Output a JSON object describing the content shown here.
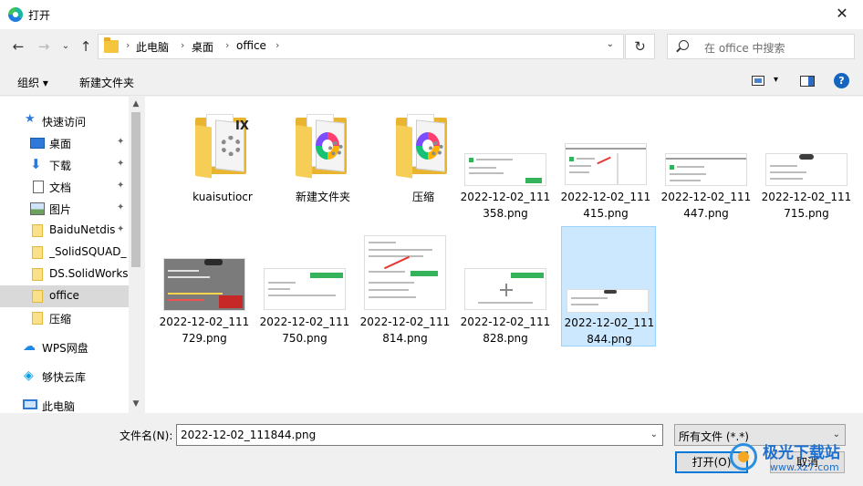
{
  "window": {
    "title": "打开",
    "close_glyph": "✕"
  },
  "address_bar": {
    "crumbs": [
      "此电脑",
      "桌面",
      "office"
    ],
    "separator": "›"
  },
  "search": {
    "placeholder": "在 office 中搜索"
  },
  "toolbar": {
    "organize": "组织 ▾",
    "new_folder": "新建文件夹",
    "help": "?"
  },
  "nav": {
    "items": [
      {
        "label": "快速访问",
        "icon": "star-icon"
      },
      {
        "label": "桌面",
        "icon": "desktop-icon",
        "pinned": true
      },
      {
        "label": "下载",
        "icon": "download-icon",
        "pinned": true
      },
      {
        "label": "文档",
        "icon": "document-icon",
        "pinned": true
      },
      {
        "label": "图片",
        "icon": "picture-icon",
        "pinned": true
      },
      {
        "label": "BaiduNetdis",
        "icon": "folder-icon",
        "pinned": true
      },
      {
        "label": "_SolidSQUAD_",
        "icon": "folder-icon"
      },
      {
        "label": "DS.SolidWorks",
        "icon": "folder-icon"
      },
      {
        "label": "office",
        "icon": "folder-icon",
        "selected": true
      },
      {
        "label": "压缩",
        "icon": "folder-icon"
      },
      {
        "label": "WPS网盘",
        "icon": "cloud-icon"
      },
      {
        "label": "够快云库",
        "icon": "cloud-drive-icon"
      },
      {
        "label": "此电脑",
        "icon": "computer-icon"
      }
    ],
    "pin_glyph": "📌"
  },
  "files": [
    {
      "name": "kuaisutiocr",
      "type": "folder"
    },
    {
      "name": "新建文件夹",
      "type": "folder"
    },
    {
      "name": "压缩",
      "type": "folder"
    },
    {
      "name": "2022-12-02_111358.png",
      "type": "image"
    },
    {
      "name": "2022-12-02_111415.png",
      "type": "image"
    },
    {
      "name": "2022-12-02_111447.png",
      "type": "image"
    },
    {
      "name": "2022-12-02_111715.png",
      "type": "image"
    },
    {
      "name": "2022-12-02_111729.png",
      "type": "image"
    },
    {
      "name": "2022-12-02_111750.png",
      "type": "image"
    },
    {
      "name": "2022-12-02_111814.png",
      "type": "image"
    },
    {
      "name": "2022-12-02_111828.png",
      "type": "image"
    },
    {
      "name": "2022-12-02_111844.png",
      "type": "image",
      "selected": true
    }
  ],
  "footer": {
    "filename_label": "文件名(N):",
    "filename_value": "2022-12-02_111844.png",
    "filetype_value": "所有文件 (*.*)",
    "open_button": "打开(O)",
    "cancel_button": "取消"
  },
  "watermark": {
    "text": "极光下载站",
    "url": "www.xz7.com"
  },
  "colors": {
    "selection": "#cce8ff",
    "accent": "#0078d7",
    "folder": "#f5c53d"
  }
}
